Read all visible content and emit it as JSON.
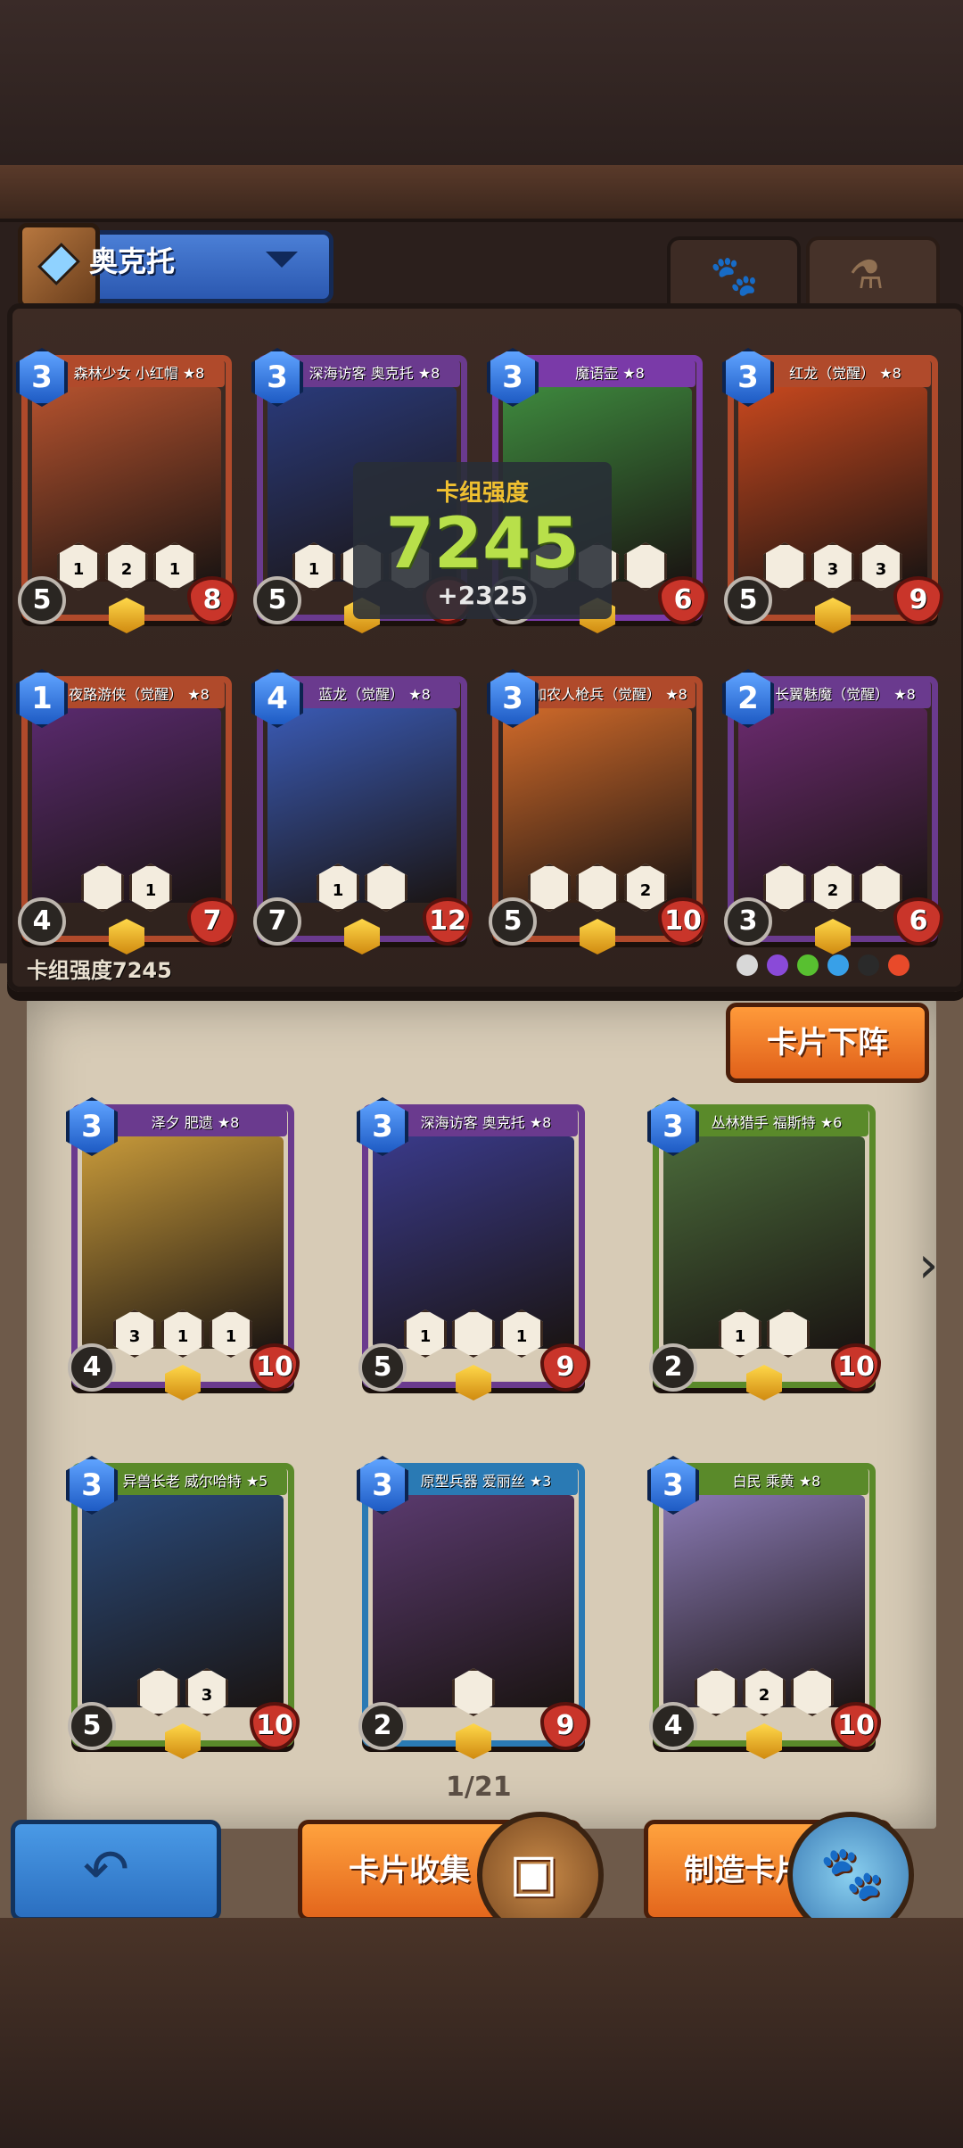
{
  "hero": {
    "name": "奥克托"
  },
  "tabs": {
    "cards_icon": "paw-icon",
    "potions_icon": "potion-icon"
  },
  "deck": [
    {
      "name": "森林少女 小红帽",
      "stars": "★8",
      "cost": "3",
      "attack": "5",
      "health": "8",
      "skills": [
        "1",
        "2",
        "1"
      ],
      "side_value": "3",
      "art": "#b5522e",
      "banner": "#b04a2b"
    },
    {
      "name": "深海访客 奥克托",
      "stars": "★8",
      "cost": "3",
      "attack": "5",
      "health": "",
      "skills": [
        "1",
        "",
        ""
      ],
      "side_value": "",
      "art": "#2a3a7a",
      "banner": "#6a3a8e"
    },
    {
      "name": "魔语壶",
      "stars": "★8",
      "cost": "3",
      "attack": "",
      "health": "6",
      "skills": [
        "",
        "",
        ""
      ],
      "side_value": "",
      "art": "#3e8a3e",
      "banner": "#7a3aa8"
    },
    {
      "name": "红龙（觉醒）",
      "stars": "★8",
      "cost": "3",
      "attack": "5",
      "health": "9",
      "skills": [
        "",
        "3",
        "3"
      ],
      "side_value": "",
      "art": "#c8481e",
      "banner": "#b04a2b"
    },
    {
      "name": "夜路游侠（觉醒）",
      "stars": "★8",
      "cost": "1",
      "attack": "4",
      "health": "7",
      "skills": [
        "",
        "1"
      ],
      "side_value": "",
      "art": "#5a2a6e",
      "banner": "#b04a2b"
    },
    {
      "name": "蓝龙（觉醒）",
      "stars": "★8",
      "cost": "4",
      "attack": "7",
      "health": "12",
      "skills": [
        "1",
        ""
      ],
      "side_value": "",
      "art": "#3a5ab4",
      "banner": "#6a3a8e"
    },
    {
      "name": "加农人枪兵（觉醒）",
      "stars": "★8",
      "cost": "3",
      "attack": "5",
      "health": "10",
      "skills": [
        "",
        "",
        "2"
      ],
      "side_value": "",
      "art": "#d06a2a",
      "banner": "#b04a2b"
    },
    {
      "name": "长翼魅魔（觉醒）",
      "stars": "★8",
      "cost": "2",
      "attack": "3",
      "health": "6",
      "skills": [
        "",
        "2",
        ""
      ],
      "side_value": "",
      "art": "#6a2a6e",
      "banner": "#6a3a8e"
    }
  ],
  "deck_strength_label": "卡组强度7245",
  "strength_popup": {
    "title": "卡组强度",
    "value": "7245",
    "delta": "+2325"
  },
  "unload_button": "卡片下阵",
  "collection": [
    {
      "name": "泽夕 肥遗",
      "stars": "★8",
      "cost": "3",
      "attack": "4",
      "health": "10",
      "skills": [
        "3",
        "1",
        "1"
      ],
      "art": "#c89a3a",
      "banner": "#6a3a8e"
    },
    {
      "name": "深海访客 奥克托",
      "stars": "★8",
      "cost": "3",
      "attack": "5",
      "health": "9",
      "skills": [
        "1",
        "",
        "1"
      ],
      "art": "#3a3a8a",
      "banner": "#6a3a8e",
      "flag": "1"
    },
    {
      "name": "丛林猎手 福斯特",
      "stars": "★6",
      "cost": "3",
      "attack": "2",
      "health": "10",
      "skills": [
        "1",
        ""
      ],
      "art": "#4a6a3a",
      "banner": "#5a8a2a"
    },
    {
      "name": "异兽长老 威尔哈特",
      "stars": "★5",
      "cost": "3",
      "attack": "5",
      "health": "10",
      "skills": [
        "",
        "3"
      ],
      "art": "#2a4a7a",
      "banner": "#5a8a2a"
    },
    {
      "name": "原型兵器 爱丽丝",
      "stars": "★3",
      "cost": "3",
      "attack": "2",
      "health": "9",
      "skills": [
        ""
      ],
      "art": "#5a3a6e",
      "banner": "#2a7ab4"
    },
    {
      "name": "白民 乘黄",
      "stars": "★8",
      "cost": "3",
      "attack": "4",
      "health": "10",
      "skills": [
        "",
        "2",
        ""
      ],
      "art": "#8a7ab4",
      "banner": "#5a8a2a"
    }
  ],
  "page_indicator": "1/21",
  "buttons": {
    "back_icon": "back-arrow-icon",
    "collection": "卡片收集",
    "craft": "制造卡片"
  },
  "element_colors": [
    "#d8d8d8",
    "#8a4ad8",
    "#58c030",
    "#38a0e8",
    "#2a2a2a",
    "#e84a2a"
  ]
}
